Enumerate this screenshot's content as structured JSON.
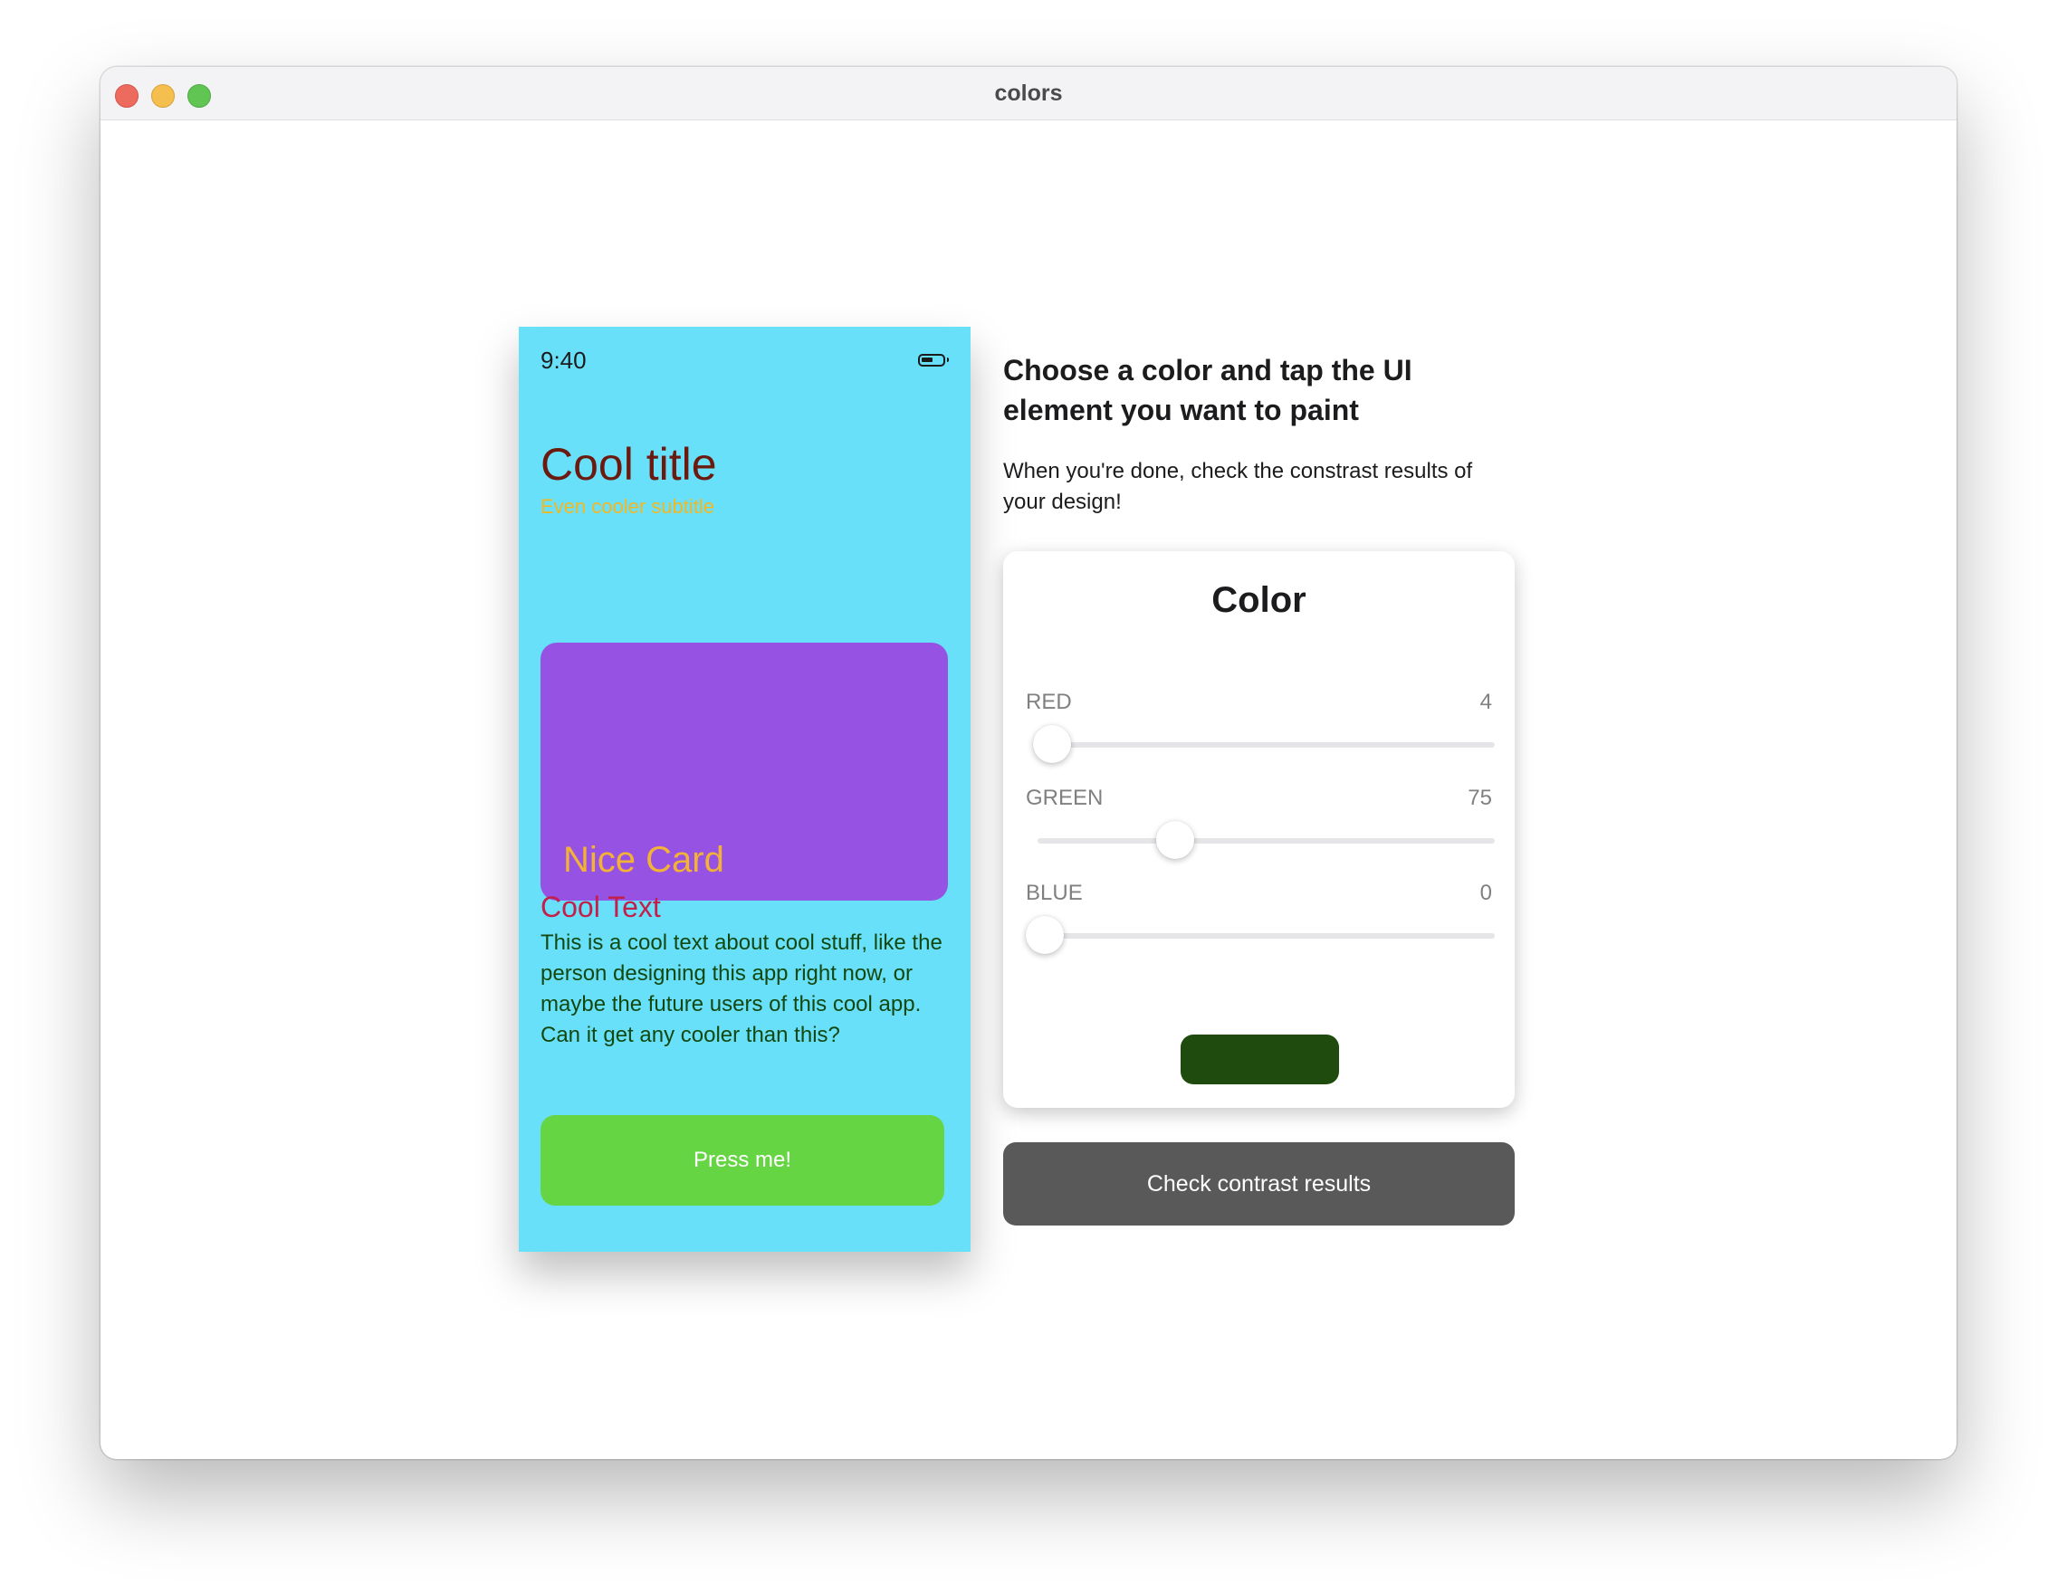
{
  "window": {
    "title": "colors"
  },
  "phone": {
    "background": "#69e0fa",
    "status_time": "9:40",
    "title": "Cool title",
    "title_color": "#6b1a0f",
    "subtitle": "Even cooler subtitle",
    "subtitle_color": "#f4b71f",
    "card": {
      "label": "Nice Card",
      "background": "#9652e2",
      "label_color": "#f3b235"
    },
    "text_heading": "Cool Text",
    "text_heading_color": "#c41e4a",
    "text_body": "This is a cool text about cool stuff, like the person designing this app right now, or maybe the future users of this cool app. Can it get any cooler than this?",
    "text_body_color": "#12480f",
    "button_label": "Press me!",
    "button_color": "#66d544"
  },
  "panel": {
    "heading": "Choose a color and tap the UI element you want to paint",
    "subheading": "When you're done, check the constrast results of your design!",
    "color_card": {
      "title": "Color",
      "channels": [
        {
          "label": "RED",
          "value": "4",
          "level": 0.0157
        },
        {
          "label": "GREEN",
          "value": "75",
          "level": 0.294
        },
        {
          "label": "BLUE",
          "value": "0",
          "level": 0.0
        }
      ],
      "swatch_color": "#204b0f"
    },
    "check_button_label": "Check contrast results",
    "check_button_color": "#595959"
  }
}
